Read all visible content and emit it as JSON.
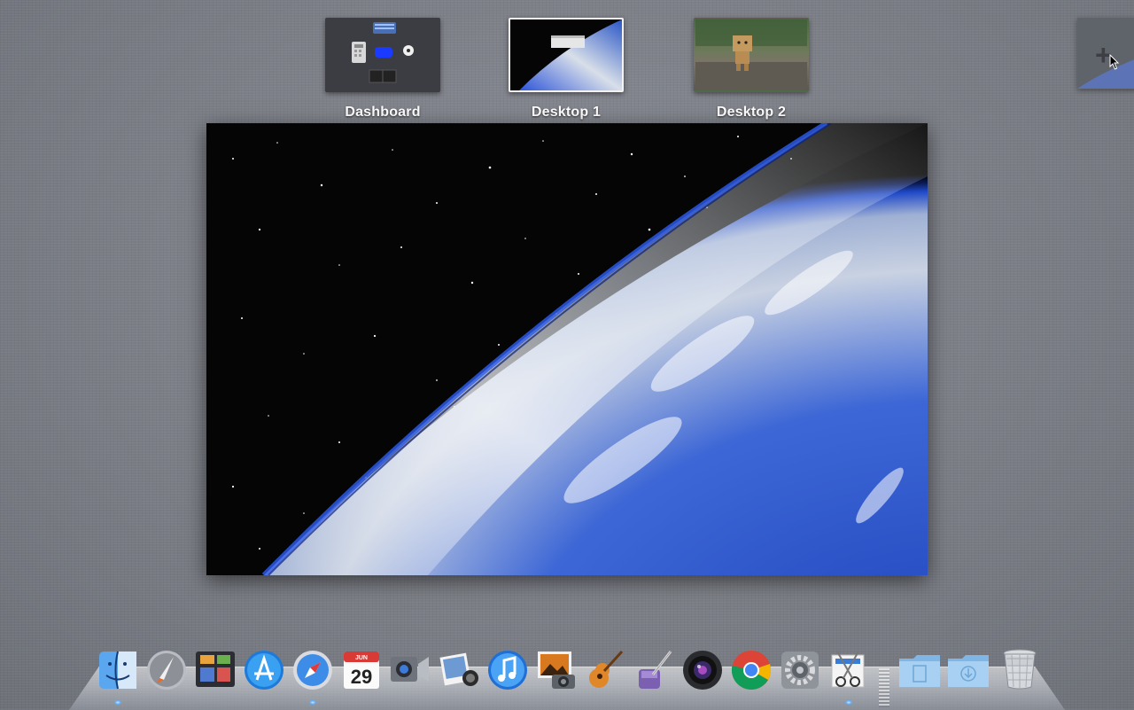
{
  "spaces": [
    {
      "id": "dashboard",
      "label": "Dashboard",
      "active": false
    },
    {
      "id": "desktop1",
      "label": "Desktop 1",
      "active": true
    },
    {
      "id": "desktop2",
      "label": "Desktop 2",
      "active": false
    }
  ],
  "add_space": {
    "icon": "plus-icon"
  },
  "calendar": {
    "month": "JUN",
    "day": "29"
  },
  "dock": {
    "apps": [
      {
        "name": "finder",
        "icon": "finder-icon"
      },
      {
        "name": "launchpad",
        "icon": "launchpad-icon"
      },
      {
        "name": "mission-control",
        "icon": "mission-control-icon"
      },
      {
        "name": "app-store",
        "icon": "app-store-icon"
      },
      {
        "name": "safari",
        "icon": "safari-icon"
      },
      {
        "name": "calendar",
        "icon": "calendar-icon"
      },
      {
        "name": "facetime",
        "icon": "facetime-icon"
      },
      {
        "name": "photo-booth",
        "icon": "photo-booth-icon"
      },
      {
        "name": "itunes",
        "icon": "itunes-icon"
      },
      {
        "name": "iphoto",
        "icon": "iphoto-icon"
      },
      {
        "name": "garageband",
        "icon": "garageband-icon"
      },
      {
        "name": "script-editor",
        "icon": "pen-icon"
      },
      {
        "name": "aperture",
        "icon": "camera-lens-icon"
      },
      {
        "name": "chrome",
        "icon": "chrome-icon"
      },
      {
        "name": "system-preferences",
        "icon": "gear-icon"
      },
      {
        "name": "grab",
        "icon": "scissors-icon"
      }
    ],
    "folders": [
      {
        "name": "documents",
        "icon": "documents-folder-icon"
      },
      {
        "name": "downloads",
        "icon": "downloads-folder-icon"
      }
    ],
    "trash": {
      "icon": "trash-icon"
    }
  },
  "colors": {
    "accent": "#3d8cf5",
    "background": "#7d8088",
    "earth_blue": "#1f49c8"
  }
}
